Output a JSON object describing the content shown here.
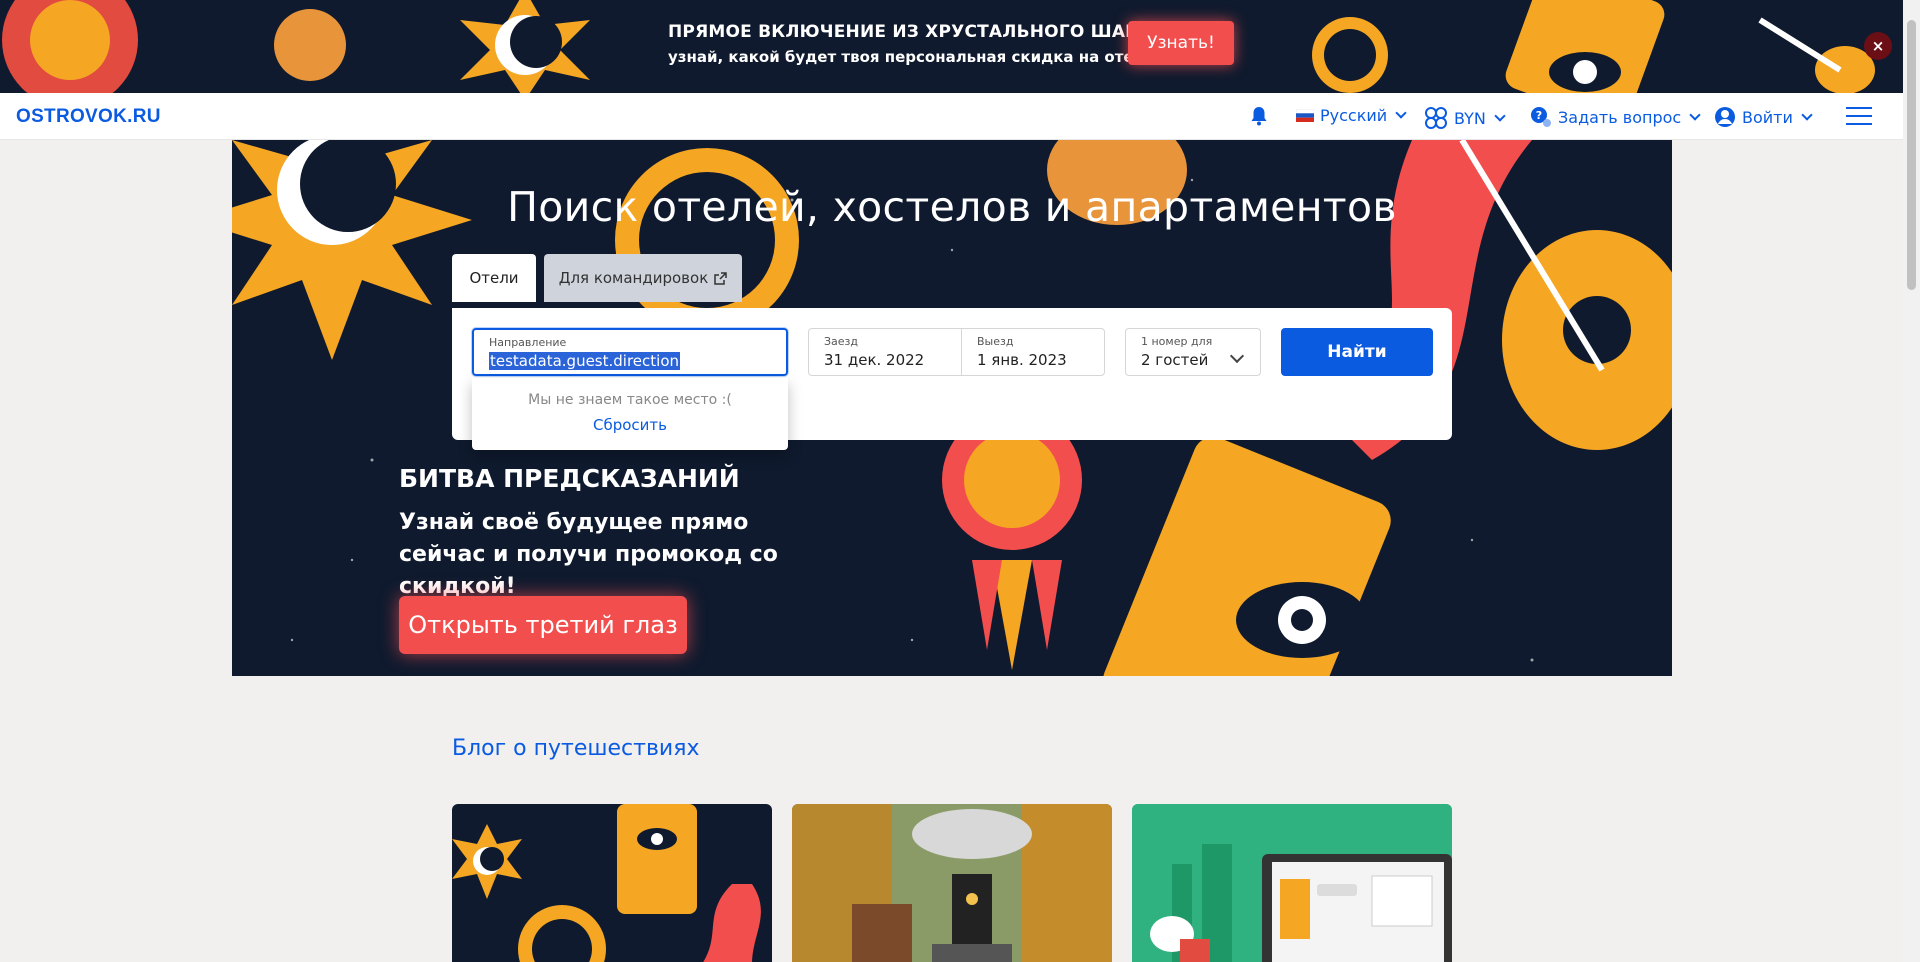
{
  "promo_banner": {
    "title": "ПРЯМОЕ ВКЛЮЧЕНИЕ ИЗ ХРУСТАЛЬНОГО ШАРА:",
    "subtitle": "узнай, какой будет твоя персональная скидка на отель!",
    "button_label": "Узнать!",
    "close_label": "×"
  },
  "header": {
    "logo": "OSTROVOK.RU",
    "language": "Русский",
    "currency": "BYN",
    "help": "Задать вопрос",
    "login": "Войти"
  },
  "hero": {
    "title": "Поиск отелей, хостелов и апартаментов",
    "tabs": [
      {
        "label": "Отели"
      },
      {
        "label": "Для командировок"
      }
    ],
    "search": {
      "direction_label": "Направление",
      "direction_value": "testadata.guest.direction",
      "checkin_label": "Заезд",
      "checkin_value": "31 дек. 2022",
      "checkout_label": "Выезд",
      "checkout_value": "1 янв. 2023",
      "guests_label": "1 номер для",
      "guests_value": "2 гостей",
      "find_button": "Найти"
    },
    "dropdown": {
      "message": "Мы не знаем такое место :(",
      "reset": "Сбросить"
    },
    "promo": {
      "title": "БИТВА ПРЕДСКАЗАНИЙ",
      "subtitle": "Узнай своё будущее прямо сейчас и получи промокод со скидкой!",
      "button": "Открыть третий глаз"
    }
  },
  "blog": {
    "title": "Блог о путешествиях"
  },
  "colors": {
    "brand": "#0b5be1",
    "accent_red": "#f24e4e",
    "dark_bg": "#0f1a2e",
    "orange": "#f5a623"
  }
}
